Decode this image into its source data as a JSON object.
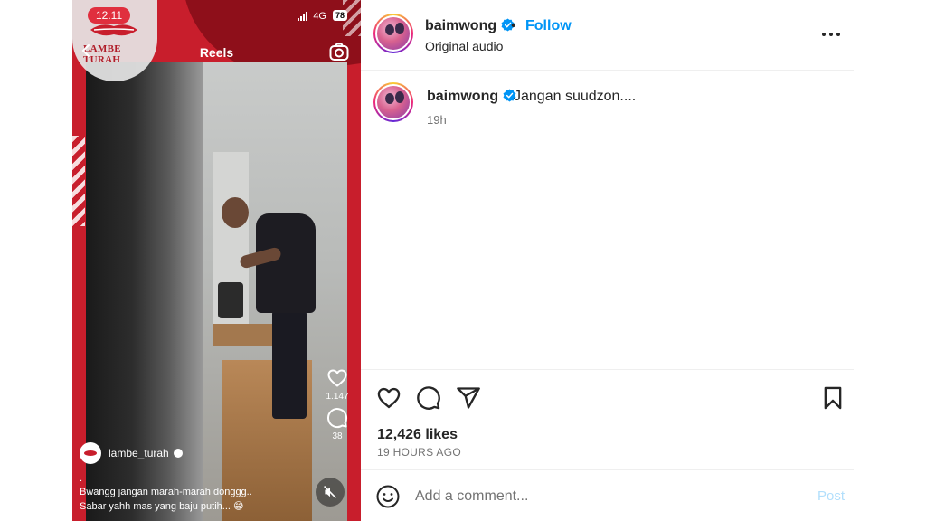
{
  "reel": {
    "status_time": "12.11",
    "network": "4G",
    "battery": "78",
    "logo_text": "LAMBE TURAH",
    "title": "Reels",
    "likes_count": "1.147",
    "comments_count": "38",
    "author": "lambe_turah",
    "caption_dot": ".",
    "caption_line1": "Bwangg jangan marah-marah donggg..",
    "caption_line2": "Sabar yahh mas yang baju putih... 😅"
  },
  "post": {
    "username": "baimwong",
    "separator": "•",
    "follow_label": "Follow",
    "audio": "Original audio",
    "caption_user": "baimwong",
    "caption_text": "Jangan suudzon....",
    "caption_time": "19h",
    "likes": "12,426 likes",
    "posted_ago": "19 HOURS AGO",
    "comment_placeholder": "Add a comment...",
    "post_label": "Post"
  },
  "colors": {
    "accent": "#0095f6",
    "verified": "#0095f6",
    "reel_red": "#c81e2c",
    "post_disabled": "#b2dffc"
  },
  "icons": [
    "back-icon",
    "camera-icon",
    "heart-icon",
    "comment-icon",
    "share-icon",
    "mute-icon",
    "more-icon",
    "verified-icon",
    "bookmark-icon",
    "emoji-icon"
  ]
}
